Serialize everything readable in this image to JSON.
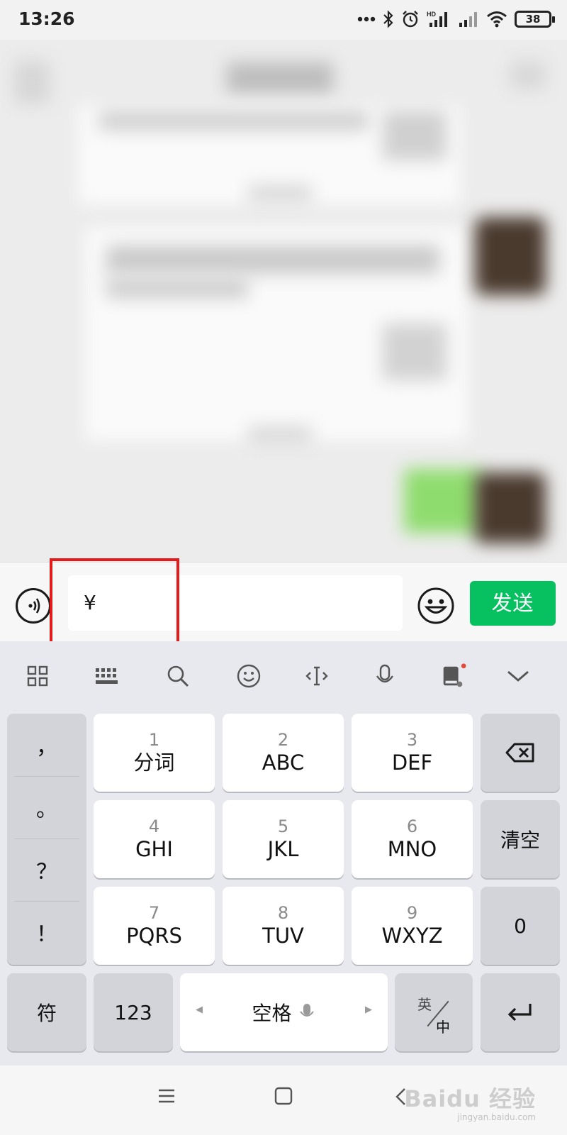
{
  "status_bar": {
    "time": "13:26",
    "battery": "38",
    "icons": [
      "more-dots-icon",
      "bluetooth-icon",
      "alarm-icon",
      "hd-signal-icon",
      "signal-icon",
      "wifi-icon",
      "battery-icon"
    ]
  },
  "chat": {
    "blurred": true
  },
  "input_bar": {
    "text_value": "¥",
    "send_label": "发送",
    "highlight_color": "#e31b1b",
    "send_color": "#07c160"
  },
  "keyboard_toolbar": {
    "icons": [
      "grid-icon",
      "keyboard-icon",
      "search-icon",
      "smiley-icon",
      "cursor-icon",
      "microphone-icon",
      "dictionary-icon",
      "chevron-down-icon"
    ]
  },
  "keyboard": {
    "punctuation": [
      "，",
      "。",
      "？",
      "！"
    ],
    "keys": [
      {
        "num": "1",
        "label": "分词"
      },
      {
        "num": "2",
        "label": "ABC"
      },
      {
        "num": "3",
        "label": "DEF"
      },
      {
        "num": "4",
        "label": "GHI"
      },
      {
        "num": "5",
        "label": "JKL"
      },
      {
        "num": "6",
        "label": "MNO"
      },
      {
        "num": "7",
        "label": "PQRS"
      },
      {
        "num": "8",
        "label": "TUV"
      },
      {
        "num": "9",
        "label": "WXYZ"
      }
    ],
    "clear_label": "清空",
    "zero_label": "0",
    "symbol_label": "符",
    "numeric_label": "123",
    "space_label": "空格",
    "lang_top": "英",
    "lang_bottom": "中"
  },
  "nav_bar": {
    "watermark": "Baidu 经验",
    "watermark_sub": "jingyan.baidu.com"
  }
}
